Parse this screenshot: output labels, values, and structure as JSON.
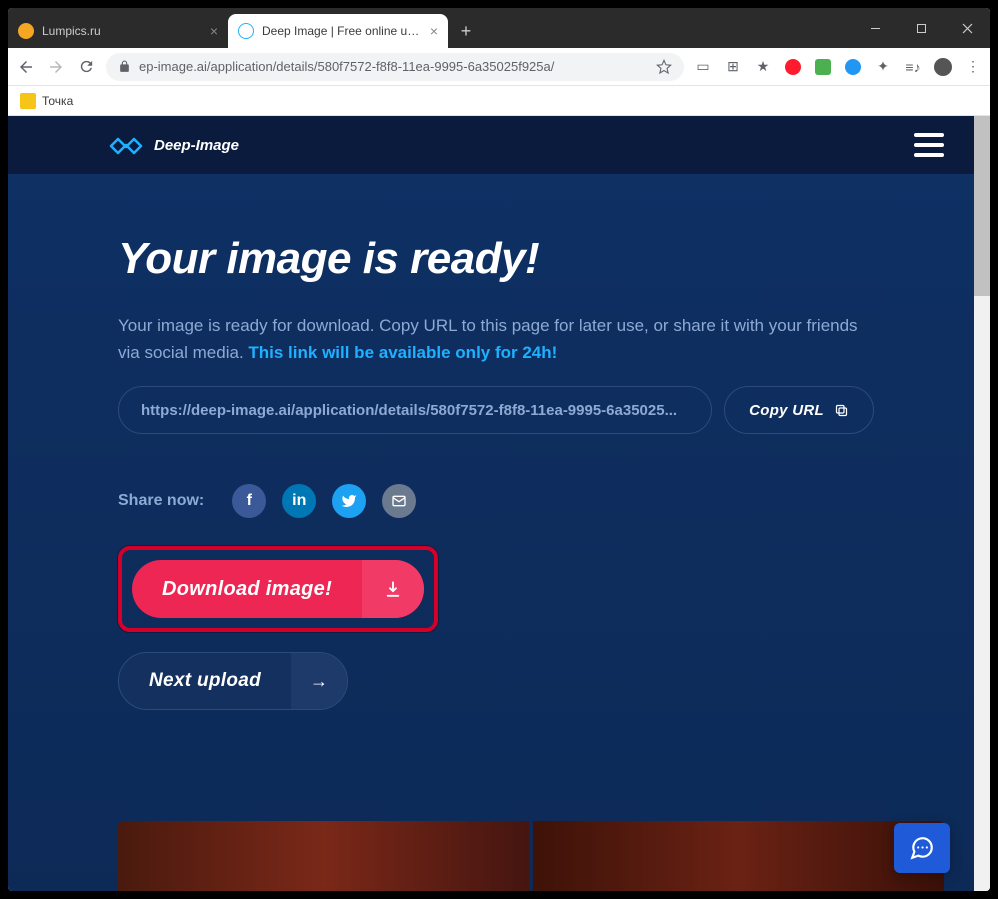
{
  "browser": {
    "tabs": [
      {
        "title": "Lumpics.ru",
        "active": false,
        "favicon_color": "#f5a623"
      },
      {
        "title": "Deep Image | Free online upscale",
        "active": true,
        "favicon_color": "#1fb0ff"
      }
    ],
    "url": "ep-image.ai/application/details/580f7572-f8f8-11ea-9995-6a35025f925a/",
    "bookmark": "Точка"
  },
  "site": {
    "brand": "Deep-Image"
  },
  "page": {
    "headline": "Your image is ready!",
    "subtext_a": "Your image is ready for download. Copy URL to this page for later use, or share it with your friends via social media. ",
    "subtext_emph": "This link will be available only for 24h!",
    "share_url": "https://deep-image.ai/application/details/580f7572-f8f8-11ea-9995-6a35025...",
    "copy_btn": "Copy URL",
    "share_label": "Share now:",
    "download_btn": "Download image!",
    "next_btn": "Next upload"
  }
}
